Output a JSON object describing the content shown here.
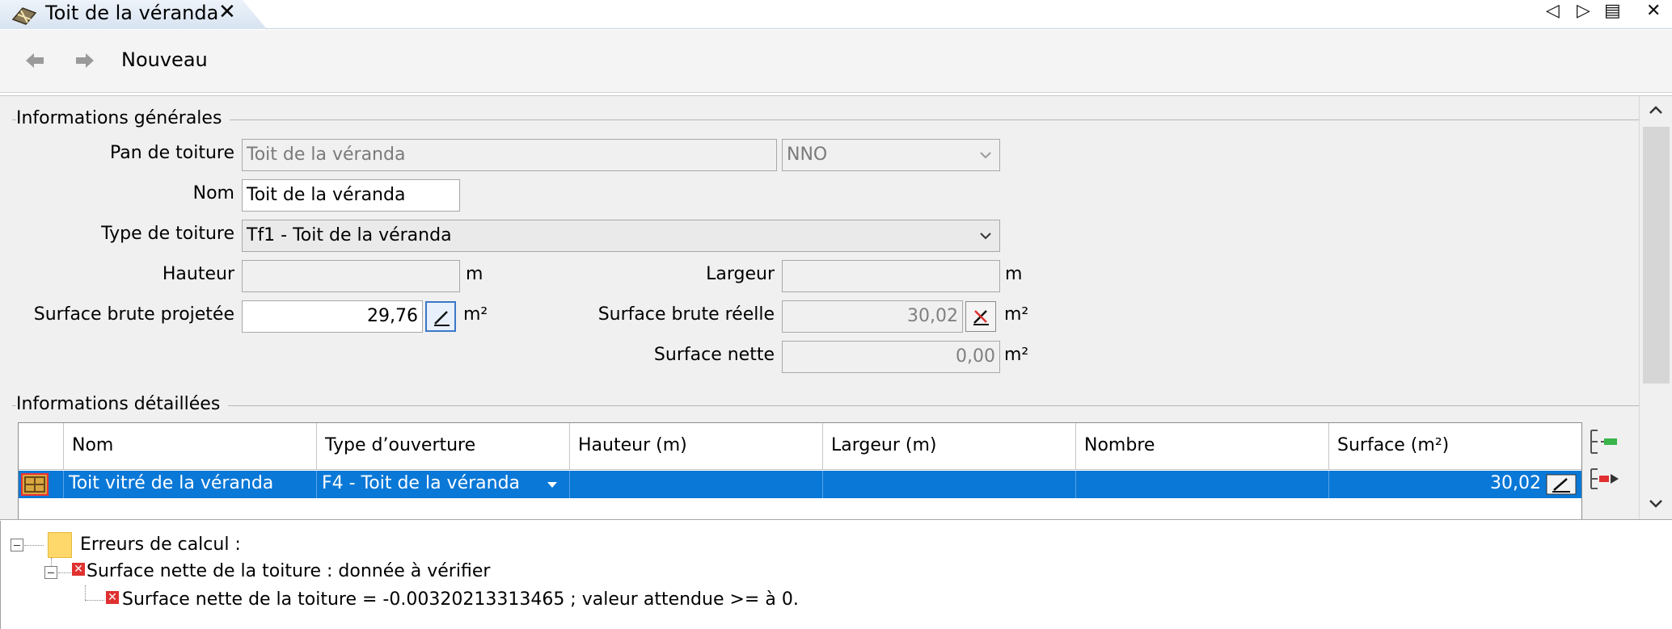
{
  "tab": {
    "title": "Toit de la véranda",
    "close": "✕"
  },
  "window_controls": {
    "prev": "◁",
    "next": "▷",
    "list": "▤",
    "close": "✕"
  },
  "toolbar": {
    "back_icon": "arrow-left-icon",
    "forward_icon": "arrow-right-icon",
    "new_label": "Nouveau"
  },
  "general": {
    "section_title": "Informations générales",
    "pan_label": "Pan de toiture",
    "pan_value": "Toit de la véranda",
    "orientation_value": "NNO",
    "nom_label": "Nom",
    "nom_value": "Toit de la véranda",
    "type_label": "Type de toiture",
    "type_value": "Tf1 - Toit de la véranda",
    "hauteur_label": "Hauteur",
    "hauteur_value": "",
    "hauteur_unit": "m",
    "largeur_label": "Largeur",
    "largeur_value": "",
    "largeur_unit": "m",
    "surface_proj_label": "Surface brute projetée",
    "surface_proj_value": "29,76",
    "surface_proj_unit": "m²",
    "surface_reelle_label": "Surface brute réelle",
    "surface_reelle_value": "30,02",
    "surface_reelle_unit": "m²",
    "surface_nette_label": "Surface nette",
    "surface_nette_value": "0,00",
    "surface_nette_unit": "m²"
  },
  "details": {
    "section_title": "Informations détaillées",
    "columns": [
      "Nom",
      "Type d’ouverture",
      "Hauteur (m)",
      "Largeur (m)",
      "Nombre",
      "Surface (m²)"
    ],
    "rows": [
      {
        "nom": "Toit vitré de la véranda",
        "type": "F4 - Toit de la véranda",
        "hauteur": "",
        "largeur": "",
        "nombre": "",
        "surface": "30,02"
      }
    ]
  },
  "errors": {
    "root": "Erreurs de calcul :",
    "child": "Surface nette de la toiture : donnée à vérifier",
    "leaf": "Surface nette de la toiture = -0.00320213313465 ; valeur attendue >= à 0."
  },
  "colors": {
    "selection": "#0a78d7",
    "error": "#e03030",
    "folder": "#ffd86b"
  }
}
